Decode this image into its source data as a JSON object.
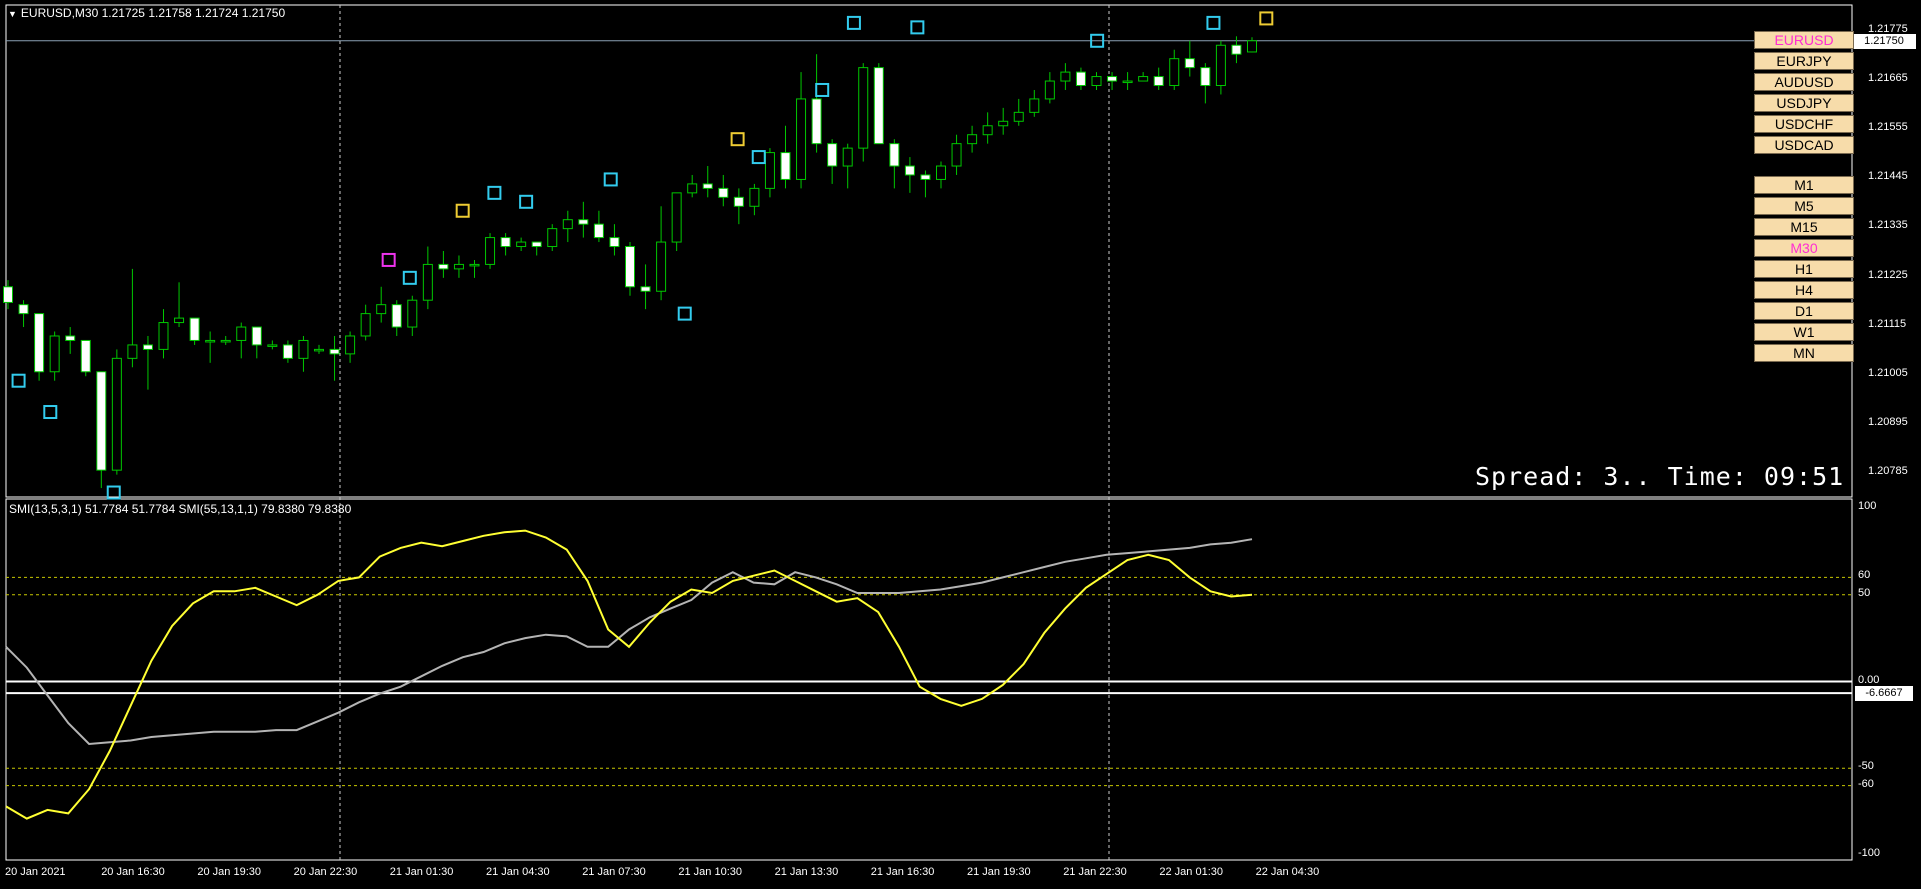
{
  "chart_title": "EURUSD,M30  1.21725 1.21758 1.21724 1.21750",
  "indicator_title": "SMI(13,5,3,1) 51.7784 51.7784  SMI(55,13,1,1) 79.8380 79.8380",
  "current_price": "1.21750",
  "spread_text": "Spread: 3.. Time: 09:51",
  "symbols": [
    {
      "label": "EURUSD",
      "active": true
    },
    {
      "label": "EURJPY",
      "active": false
    },
    {
      "label": "AUDUSD",
      "active": false
    },
    {
      "label": "USDJPY",
      "active": false
    },
    {
      "label": "USDCHF",
      "active": false
    },
    {
      "label": "USDCAD",
      "active": false
    }
  ],
  "timeframes": [
    {
      "label": "M1",
      "active": false
    },
    {
      "label": "M5",
      "active": false
    },
    {
      "label": "M15",
      "active": false
    },
    {
      "label": "M30",
      "active": true
    },
    {
      "label": "H1",
      "active": false
    },
    {
      "label": "H4",
      "active": false
    },
    {
      "label": "D1",
      "active": false
    },
    {
      "label": "W1",
      "active": false
    },
    {
      "label": "MN",
      "active": false
    }
  ],
  "price_axis": [
    "1.21775",
    "1.21665",
    "1.21555",
    "1.21445",
    "1.21335",
    "1.21225",
    "1.21115",
    "1.21005",
    "1.20895",
    "1.20785"
  ],
  "indicator_axis": [
    "100",
    "60",
    "50",
    "0.00",
    "-50",
    "-60",
    "-100"
  ],
  "indicator_current": "-6.6667",
  "time_axis": [
    "20 Jan 2021",
    "20 Jan 16:30",
    "20 Jan 19:30",
    "20 Jan 22:30",
    "21 Jan 01:30",
    "21 Jan 04:30",
    "21 Jan 07:30",
    "21 Jan 10:30",
    "21 Jan 13:30",
    "21 Jan 16:30",
    "21 Jan 19:30",
    "21 Jan 22:30",
    "22 Jan 01:30",
    "22 Jan 04:30"
  ],
  "colors": {
    "background": "#000000",
    "bull_candle": "#000000",
    "bear_candle": "#ffffff",
    "wick": "#00c800",
    "smi_fast": "#ffff33",
    "smi_slow": "#b4b4b4",
    "marker_cyan": "#33ccee",
    "marker_yellow": "#eecc33",
    "marker_magenta": "#ee33ee",
    "level_line": "#c8c800"
  },
  "chart_data": {
    "type": "candlestick",
    "title": "EURUSD,M30",
    "y_range": [
      1.2073,
      1.2183
    ],
    "candles": [
      [
        1.212,
        1.21215,
        1.2115,
        1.21165
      ],
      [
        1.2116,
        1.2117,
        1.2111,
        1.2114
      ],
      [
        1.2114,
        1.2114,
        1.2099,
        1.2101
      ],
      [
        1.2101,
        1.211,
        1.2099,
        1.2109
      ],
      [
        1.2109,
        1.2111,
        1.2105,
        1.2108
      ],
      [
        1.2108,
        1.2108,
        1.21,
        1.2101
      ],
      [
        1.2101,
        1.2101,
        1.2075,
        1.2079
      ],
      [
        1.2079,
        1.2106,
        1.2078,
        1.2104
      ],
      [
        1.2104,
        1.2124,
        1.2102,
        1.2107
      ],
      [
        1.2107,
        1.2109,
        1.2097,
        1.2106
      ],
      [
        1.2106,
        1.2115,
        1.2104,
        1.2112
      ],
      [
        1.2112,
        1.2121,
        1.2111,
        1.2113
      ],
      [
        1.2113,
        1.2113,
        1.2107,
        1.2108
      ],
      [
        1.2108,
        1.211,
        1.2103,
        1.2108
      ],
      [
        1.2108,
        1.2109,
        1.2107,
        1.2108
      ],
      [
        1.2108,
        1.2112,
        1.2104,
        1.2111
      ],
      [
        1.2111,
        1.2111,
        1.2104,
        1.2107
      ],
      [
        1.2107,
        1.2108,
        1.2106,
        1.2107
      ],
      [
        1.2107,
        1.2108,
        1.2103,
        1.2104
      ],
      [
        1.2104,
        1.2109,
        1.2101,
        1.2108
      ],
      [
        1.2106,
        1.2107,
        1.2105,
        1.2106
      ],
      [
        1.2106,
        1.2109,
        1.2099,
        1.2105
      ],
      [
        1.2105,
        1.211,
        1.2103,
        1.2109
      ],
      [
        1.2109,
        1.2116,
        1.2108,
        1.2114
      ],
      [
        1.2114,
        1.212,
        1.2112,
        1.2116
      ],
      [
        1.2116,
        1.2117,
        1.2109,
        1.2111
      ],
      [
        1.2111,
        1.2118,
        1.2109,
        1.2117
      ],
      [
        1.2117,
        1.2129,
        1.2115,
        1.2125
      ],
      [
        1.2125,
        1.2128,
        1.2122,
        1.2124
      ],
      [
        1.2124,
        1.2127,
        1.2122,
        1.2125
      ],
      [
        1.2125,
        1.2126,
        1.2122,
        1.2125
      ],
      [
        1.2125,
        1.2132,
        1.2124,
        1.2131
      ],
      [
        1.2131,
        1.2132,
        1.2127,
        1.2129
      ],
      [
        1.2129,
        1.2131,
        1.2128,
        1.213
      ],
      [
        1.213,
        1.213,
        1.2127,
        1.2129
      ],
      [
        1.2129,
        1.2134,
        1.2128,
        1.2133
      ],
      [
        1.2133,
        1.2137,
        1.213,
        1.2135
      ],
      [
        1.2135,
        1.2139,
        1.2131,
        1.2134
      ],
      [
        1.2134,
        1.2137,
        1.213,
        1.2131
      ],
      [
        1.2131,
        1.2134,
        1.2127,
        1.2129
      ],
      [
        1.2129,
        1.213,
        1.2118,
        1.212
      ],
      [
        1.212,
        1.2125,
        1.2115,
        1.2119
      ],
      [
        1.2119,
        1.2138,
        1.2117,
        1.213
      ],
      [
        1.213,
        1.2141,
        1.2128,
        1.2141
      ],
      [
        1.2141,
        1.2145,
        1.214,
        1.2143
      ],
      [
        1.2143,
        1.2147,
        1.214,
        1.2142
      ],
      [
        1.2142,
        1.2145,
        1.2138,
        1.214
      ],
      [
        1.214,
        1.2142,
        1.2134,
        1.2138
      ],
      [
        1.2138,
        1.2143,
        1.2136,
        1.2142
      ],
      [
        1.2142,
        1.2151,
        1.214,
        1.215
      ],
      [
        1.215,
        1.2156,
        1.2142,
        1.2144
      ],
      [
        1.2144,
        1.2168,
        1.2142,
        1.2162
      ],
      [
        1.2162,
        1.2172,
        1.215,
        1.2152
      ],
      [
        1.2152,
        1.2153,
        1.2143,
        1.2147
      ],
      [
        1.2147,
        1.2152,
        1.2142,
        1.2151
      ],
      [
        1.2151,
        1.217,
        1.2148,
        1.2169
      ],
      [
        1.2169,
        1.217,
        1.2152,
        1.2152
      ],
      [
        1.2152,
        1.2153,
        1.2142,
        1.2147
      ],
      [
        1.2147,
        1.2149,
        1.2141,
        1.2145
      ],
      [
        1.2145,
        1.2146,
        1.214,
        1.2144
      ],
      [
        1.2144,
        1.2148,
        1.2142,
        1.2147
      ],
      [
        1.2147,
        1.2154,
        1.2145,
        1.2152
      ],
      [
        1.2152,
        1.2156,
        1.215,
        1.2154
      ],
      [
        1.2154,
        1.2159,
        1.2152,
        1.2156
      ],
      [
        1.2156,
        1.216,
        1.2154,
        1.2157
      ],
      [
        1.2157,
        1.2162,
        1.2156,
        1.2159
      ],
      [
        1.2159,
        1.2164,
        1.2158,
        1.2162
      ],
      [
        1.2162,
        1.2168,
        1.2161,
        1.2166
      ],
      [
        1.2166,
        1.217,
        1.2164,
        1.2168
      ],
      [
        1.2168,
        1.2169,
        1.2164,
        1.2165
      ],
      [
        1.2165,
        1.2168,
        1.2164,
        1.2167
      ],
      [
        1.2167,
        1.2168,
        1.2164,
        1.2166
      ],
      [
        1.2166,
        1.2168,
        1.2164,
        1.2166
      ],
      [
        1.2166,
        1.2168,
        1.2166,
        1.2167
      ],
      [
        1.2167,
        1.2169,
        1.2164,
        1.2165
      ],
      [
        1.2165,
        1.2173,
        1.2164,
        1.2171
      ],
      [
        1.2171,
        1.2175,
        1.2167,
        1.2169
      ],
      [
        1.2169,
        1.217,
        1.2161,
        1.2165
      ],
      [
        1.2165,
        1.2175,
        1.2163,
        1.2174
      ],
      [
        1.2174,
        1.2176,
        1.217,
        1.2172
      ],
      [
        1.21725,
        1.21758,
        1.21724,
        1.2175
      ]
    ],
    "markers": [
      {
        "bar": 1,
        "price": 1.2099,
        "color": "cyan"
      },
      {
        "bar": 4,
        "price": 1.2092,
        "color": "cyan"
      },
      {
        "bar": 10,
        "price": 1.2074,
        "color": "cyan"
      },
      {
        "bar": 36,
        "price": 1.2126,
        "color": "magenta"
      },
      {
        "bar": 38,
        "price": 1.2122,
        "color": "cyan"
      },
      {
        "bar": 43,
        "price": 1.2137,
        "color": "yellow"
      },
      {
        "bar": 46,
        "price": 1.2141,
        "color": "cyan"
      },
      {
        "bar": 49,
        "price": 1.2139,
        "color": "cyan"
      },
      {
        "bar": 57,
        "price": 1.2144,
        "color": "cyan"
      },
      {
        "bar": 64,
        "price": 1.2114,
        "color": "cyan"
      },
      {
        "bar": 69,
        "price": 1.2153,
        "color": "yellow"
      },
      {
        "bar": 71,
        "price": 1.2149,
        "color": "cyan"
      },
      {
        "bar": 77,
        "price": 1.2164,
        "color": "cyan"
      },
      {
        "bar": 80,
        "price": 1.2179,
        "color": "cyan"
      },
      {
        "bar": 86,
        "price": 1.2178,
        "color": "cyan"
      },
      {
        "bar": 103,
        "price": 1.2175,
        "color": "cyan"
      },
      {
        "bar": 114,
        "price": 1.2179,
        "color": "cyan"
      },
      {
        "bar": 119,
        "price": 1.218,
        "color": "yellow"
      }
    ],
    "indicator": {
      "y_range": [
        -100,
        100
      ],
      "levels": [
        60,
        50,
        0,
        -50,
        -60
      ],
      "fast": [
        -72,
        -79,
        -74,
        -76,
        -62,
        -40,
        -14,
        12,
        32,
        45,
        52,
        52,
        54,
        49,
        44,
        50,
        58,
        60,
        72,
        77,
        80,
        78,
        81,
        84,
        86,
        87,
        83,
        76,
        58,
        30,
        20,
        34,
        46,
        53,
        51,
        58,
        61,
        64,
        58,
        52,
        46,
        48,
        40,
        20,
        -3,
        -10,
        -14,
        -10,
        -2,
        10,
        28,
        42,
        54,
        62,
        70,
        73,
        70,
        60,
        52,
        49,
        50
      ],
      "slow": [
        20,
        8,
        -8,
        -24,
        -36,
        -35,
        -34,
        -32,
        -31,
        -30,
        -29,
        -29,
        -29,
        -28,
        -28,
        -23,
        -18,
        -12,
        -7,
        -3,
        3,
        9,
        14,
        17,
        22,
        25,
        27,
        26,
        20,
        20,
        30,
        37,
        42,
        47,
        57,
        63,
        57,
        56,
        63,
        60,
        56,
        51,
        51,
        51,
        52,
        53,
        55,
        57,
        60,
        63,
        66,
        69,
        71,
        73,
        74,
        75,
        76,
        77,
        79,
        80,
        82
      ]
    }
  }
}
